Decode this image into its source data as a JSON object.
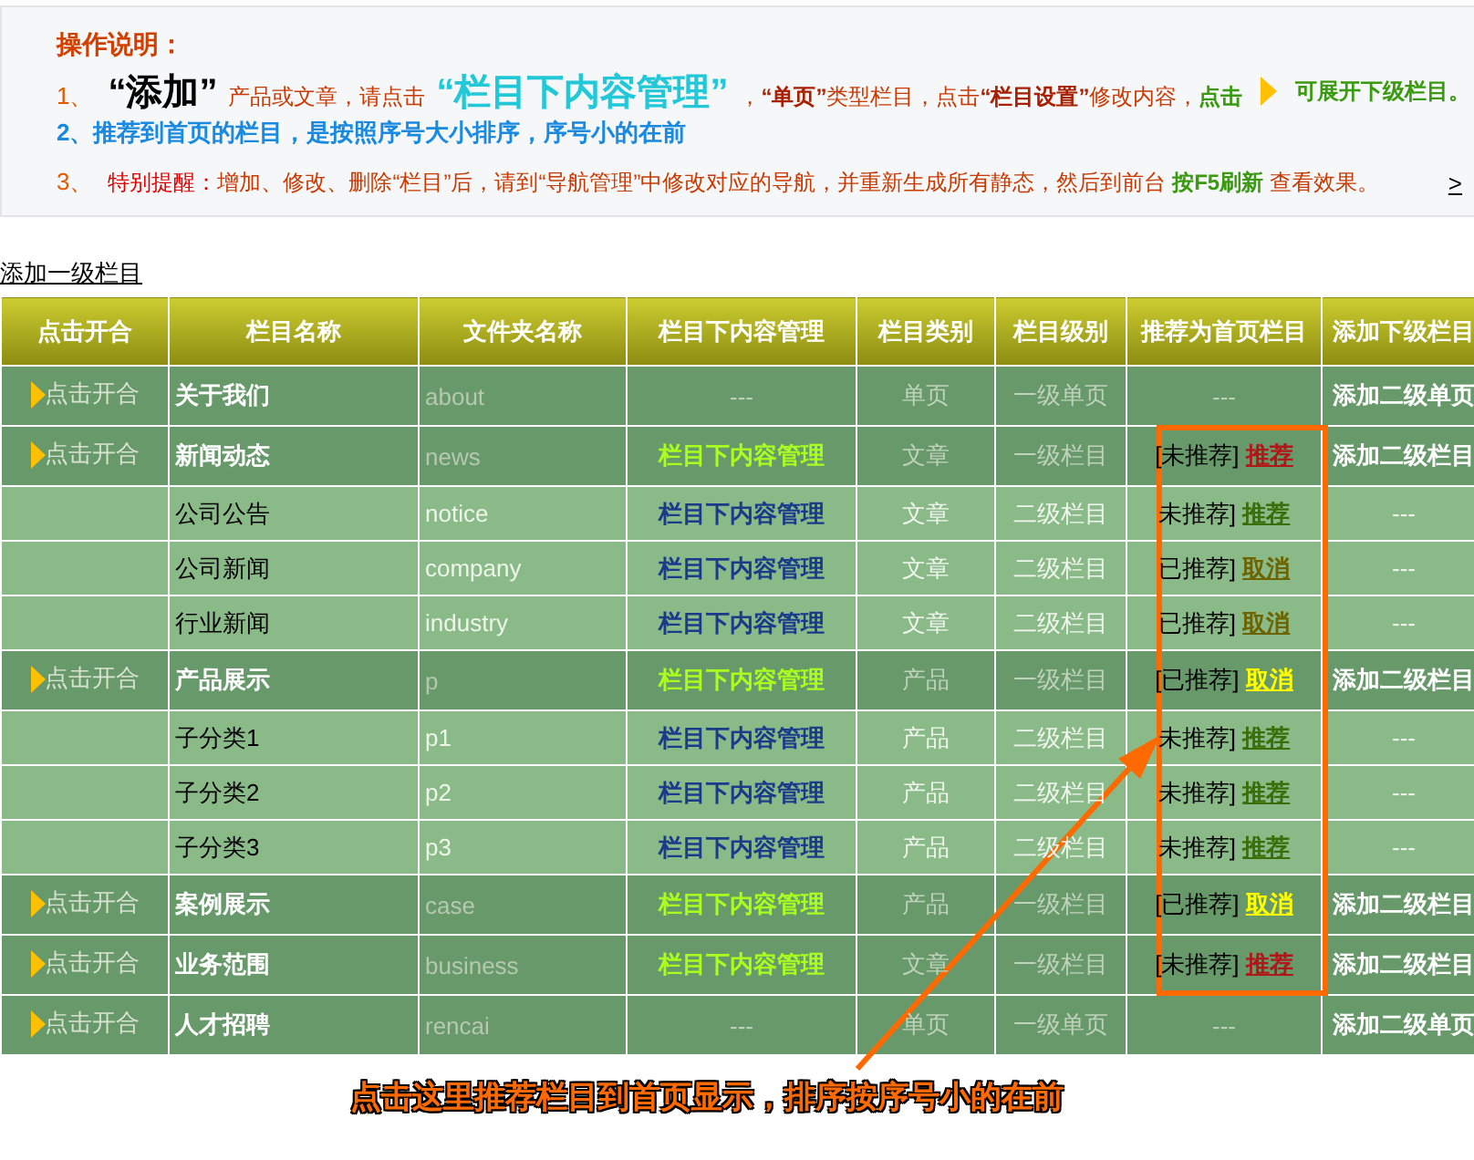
{
  "instructions": {
    "title": "操作说明：",
    "lines": [
      {
        "parts": [
          {
            "kind": "num",
            "text": "1、"
          },
          {
            "kind": "big",
            "text": "“添加”"
          },
          {
            "kind": "text",
            "text": "产品或文章，请点击"
          },
          {
            "kind": "cyan",
            "text": "“栏目下内容管理”"
          },
          {
            "kind": "text",
            "text": "，"
          },
          {
            "kind": "strong",
            "text": "“单页”"
          },
          {
            "kind": "text",
            "text": "类型栏目，点击"
          },
          {
            "kind": "strong",
            "text": "“栏目设置”"
          },
          {
            "kind": "text",
            "text": "修改内容，"
          },
          {
            "kind": "green",
            "text": "点击"
          },
          {
            "kind": "icon"
          },
          {
            "kind": "green",
            "text": "可展开下级栏目。"
          }
        ]
      },
      {
        "parts": [
          {
            "kind": "blue",
            "text": "2、推荐到首页的栏目，是按照序号大小排序，序号小的在前"
          }
        ]
      },
      {
        "parts": [
          {
            "kind": "num",
            "text": "3、"
          },
          {
            "kind": "red",
            "text": "特别提醒："
          },
          {
            "kind": "text",
            "text": "增加、修改、删除“栏目”后，请到“导航管理”中修改对应的导航，并重新生成所有静态，然后到前台 "
          },
          {
            "kind": "green",
            "text": "按F5刷新"
          },
          {
            "kind": "text",
            "text": " 查看效果。"
          }
        ]
      }
    ],
    "more_link": ">"
  },
  "add_top_link": "添加一级栏目",
  "table": {
    "columns": [
      "点击开合",
      "栏目名称",
      "文件夹名称",
      "栏目下内容管理",
      "栏目类别",
      "栏目级别",
      "推荐为首页栏目",
      "添加下级栏目"
    ],
    "rows": [
      {
        "expand_label": "点击开合",
        "name": "关于我们",
        "folder": "about",
        "content": "---",
        "type": "单页",
        "level": "一级单页",
        "status": "---",
        "add_sub": "添加二级单页"
      },
      {
        "expand_label": "点击开合",
        "name": "新闻动态",
        "folder": "news",
        "content": "栏目下内容管理",
        "type": "文章",
        "level": "一级栏目",
        "status": "[未推荐]",
        "recommended": false,
        "action": "推荐",
        "add_sub": "添加二级栏目",
        "children": [
          {
            "name": "公司公告",
            "folder": "notice",
            "content": "栏目下内容管理",
            "type": "文章",
            "level": "二级栏目",
            "status": "未推荐]",
            "recommended": false,
            "action": "推荐",
            "add_sub": "---"
          },
          {
            "name": "公司新闻",
            "folder": "company",
            "content": "栏目下内容管理",
            "type": "文章",
            "level": "二级栏目",
            "status": "已推荐]",
            "recommended": true,
            "action": "取消",
            "add_sub": "---"
          },
          {
            "name": "行业新闻",
            "folder": "industry",
            "content": "栏目下内容管理",
            "type": "文章",
            "level": "二级栏目",
            "status": "已推荐]",
            "recommended": true,
            "action": "取消",
            "add_sub": "---"
          }
        ]
      },
      {
        "expand_label": "点击开合",
        "name": "产品展示",
        "folder": "p",
        "content": "栏目下内容管理",
        "type": "产品",
        "level": "一级栏目",
        "status": "[已推荐]",
        "recommended": true,
        "action": "取消",
        "add_sub": "添加二级栏目",
        "children": [
          {
            "name": "子分类1",
            "folder": "p1",
            "content": "栏目下内容管理",
            "type": "产品",
            "level": "二级栏目",
            "status": "未推荐]",
            "recommended": false,
            "action": "推荐",
            "add_sub": "---"
          },
          {
            "name": "子分类2",
            "folder": "p2",
            "content": "栏目下内容管理",
            "type": "产品",
            "level": "二级栏目",
            "status": "未推荐]",
            "recommended": false,
            "action": "推荐",
            "add_sub": "---"
          },
          {
            "name": "子分类3",
            "folder": "p3",
            "content": "栏目下内容管理",
            "type": "产品",
            "level": "二级栏目",
            "status": "未推荐]",
            "recommended": false,
            "action": "推荐",
            "add_sub": "---"
          }
        ]
      },
      {
        "expand_label": "点击开合",
        "name": "案例展示",
        "folder": "case",
        "content": "栏目下内容管理",
        "type": "产品",
        "level": "一级栏目",
        "status": "[已推荐]",
        "recommended": true,
        "action": "取消",
        "add_sub": "添加二级栏目"
      },
      {
        "expand_label": "点击开合",
        "name": "业务范围",
        "folder": "business",
        "content": "栏目下内容管理",
        "type": "文章",
        "level": "一级栏目",
        "status": "[未推荐]",
        "recommended": false,
        "action": "推荐",
        "add_sub": "添加二级栏目"
      },
      {
        "expand_label": "点击开合",
        "name": "人才招聘",
        "folder": "rencai",
        "content": "---",
        "type": "单页",
        "level": "一级单页",
        "status": "---",
        "add_sub": "添加二级单页"
      }
    ]
  },
  "annotation": {
    "callout": "点击这里推荐栏目到首页显示，排序按序号小的在前"
  }
}
